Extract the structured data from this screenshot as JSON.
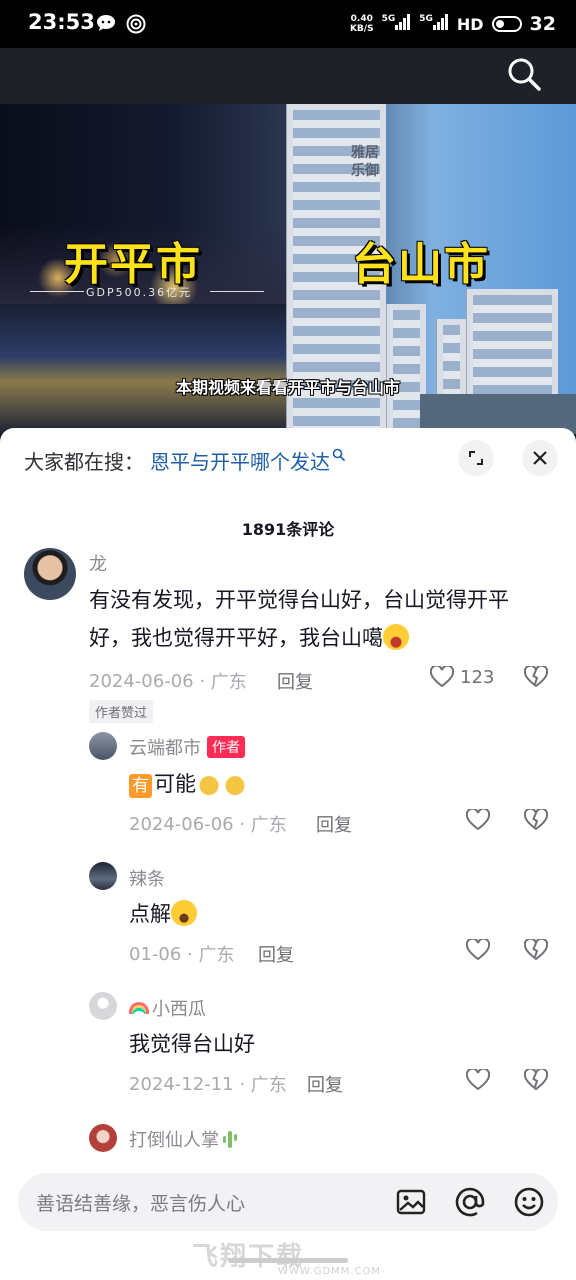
{
  "status_bar": {
    "time": "23:53",
    "net_speed_top": "0.40",
    "net_speed_bottom": "KB/S",
    "sig1": "5G",
    "sig2": "5G",
    "hd": "HD",
    "battery": "32"
  },
  "video": {
    "left_city": "开平市",
    "left_gdp": "GDP500.36亿元",
    "right_city": "台山市",
    "building_sign": "雅居乐御",
    "subtitle": "本期视频来看看开平市与台山市"
  },
  "sheet": {
    "hot_search_label": "大家都在搜：",
    "hot_search_term": "恩平与开平哪个发达",
    "comment_count": "1891条评论"
  },
  "comments": [
    {
      "user": "龙",
      "text_line1": "有没有发现，开平觉得台山好，台山觉得开平",
      "text_line2": "好，我也觉得开平好，我台山噶",
      "date": "2024-06-06",
      "location": "广东",
      "reply": "回复",
      "likes": "123",
      "author_liked": "作者赞过"
    }
  ],
  "replies": [
    {
      "user": "云端都市",
      "author_tag": "作者",
      "tag_char": "有",
      "text": "可能",
      "date": "2024-06-06",
      "location": "广东",
      "reply": "回复"
    },
    {
      "user": "辣条",
      "text": "点解",
      "date": "01-06",
      "location": "广东",
      "reply": "回复"
    },
    {
      "user": "小西瓜",
      "text": "我觉得台山好",
      "date": "2024-12-11",
      "location": "广东",
      "reply": "回复"
    },
    {
      "user": "打倒仙人掌"
    }
  ],
  "input": {
    "placeholder": "善语结善缘，恶言伤人心"
  },
  "watermark": {
    "text": "飞翔下载",
    "url": "WWW.GDMM.COM"
  },
  "colors": {
    "accent_red": "#fe2c55",
    "link_blue": "#1f5fa8",
    "title_yellow": "#ffe21a"
  }
}
